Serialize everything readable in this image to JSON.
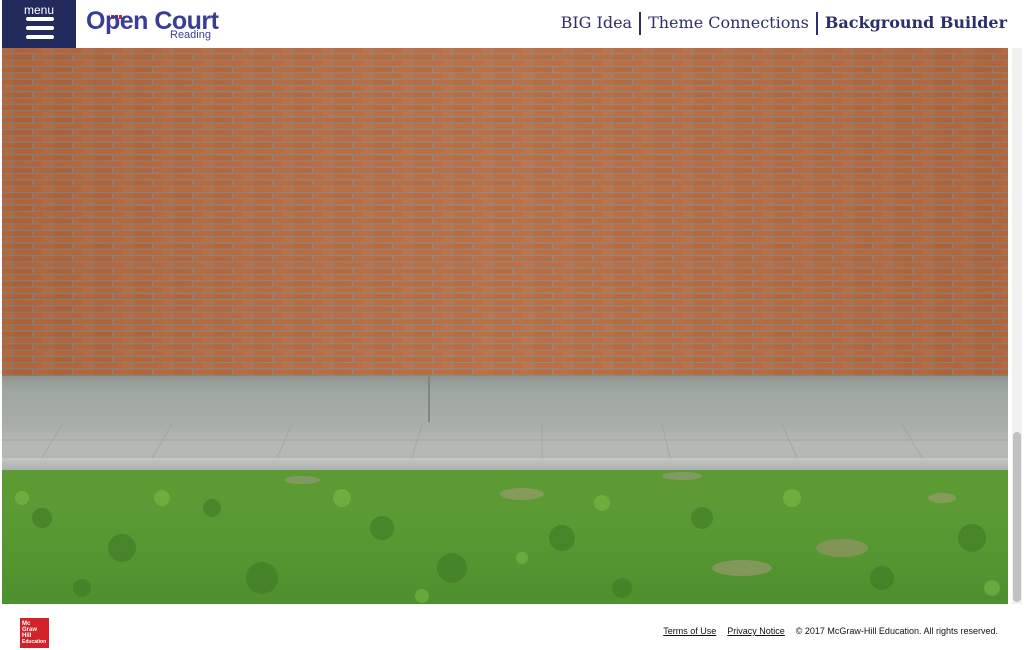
{
  "header": {
    "menu_label": "menu",
    "logo": {
      "name": "Open Court",
      "sub": "Reading"
    },
    "nav": [
      "BIG Idea",
      "Theme Connections",
      "Background Builder"
    ],
    "active_nav": "Background Builder"
  },
  "main": {
    "image_subject": "brick wall above a concrete sidewalk and grass"
  },
  "footer": {
    "logo_lines": [
      "Mc",
      "Graw",
      "Hill",
      "Education"
    ],
    "links": [
      "Terms of Use",
      "Privacy Notice"
    ],
    "copyright": "© 2017 McGraw-Hill Education. All rights reserved."
  },
  "colors": {
    "menu_bg": "#232a5c",
    "brand_text": "#3a3d96",
    "brick": "#b8683c",
    "mortar": "#8c8680",
    "grass": "#5a9a34",
    "mh_red": "#d2232a"
  },
  "icons": [
    "menu-hamburger-icon",
    "mcgraw-hill-logo-icon"
  ]
}
